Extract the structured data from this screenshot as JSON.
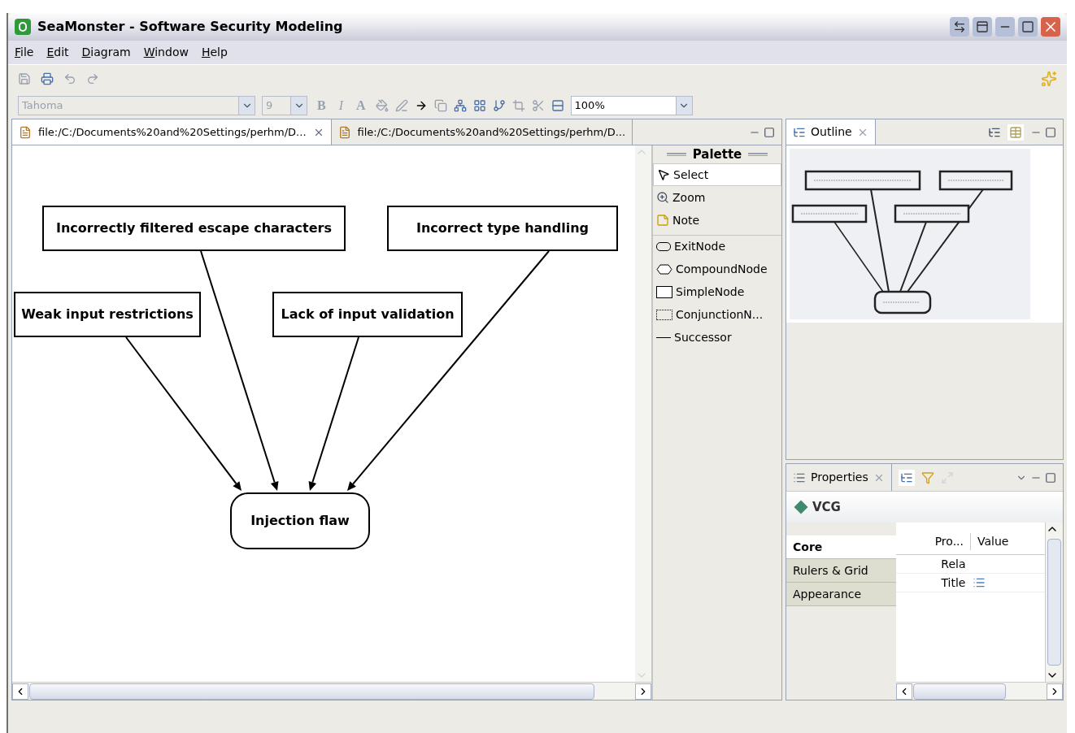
{
  "window": {
    "title": "SeaMonster - Software Security Modeling"
  },
  "menu": [
    "File",
    "Edit",
    "Diagram",
    "Window",
    "Help"
  ],
  "toolbar": {
    "font": "Tahoma",
    "size": "9",
    "format_buttons": [
      "B",
      "I",
      "A"
    ],
    "zoom": "100%"
  },
  "editor_tabs": [
    {
      "label": "file:/C:/Documents%20and%20Settings/perhm/D...",
      "selected": true
    },
    {
      "label": "file:/C:/Documents%20and%20Settings/perhm/D...",
      "selected": false
    }
  ],
  "diagram": {
    "nodes": [
      {
        "label": "Incorrectly filtered escape characters",
        "kind": "cause"
      },
      {
        "label": "Incorrect type handling",
        "kind": "cause"
      },
      {
        "label": "Weak input restrictions",
        "kind": "cause"
      },
      {
        "label": "Lack of input validation",
        "kind": "cause"
      },
      {
        "label": "Injection flaw",
        "kind": "effect"
      }
    ]
  },
  "palette": {
    "title": "Palette",
    "items": [
      {
        "label": "Select",
        "kind": "select",
        "selected": true
      },
      {
        "label": "Zoom",
        "kind": "zoom",
        "selected": false
      },
      {
        "label": "Note",
        "kind": "note",
        "selected": false
      },
      {
        "label": "ExitNode",
        "kind": "exit",
        "selected": false
      },
      {
        "label": "CompoundNode",
        "kind": "compound",
        "selected": false
      },
      {
        "label": "SimpleNode",
        "kind": "simple",
        "selected": false
      },
      {
        "label": "ConjunctionN...",
        "kind": "conjunction",
        "selected": false
      },
      {
        "label": "Successor",
        "kind": "successor",
        "selected": false
      }
    ]
  },
  "outline": {
    "title": "Outline"
  },
  "properties": {
    "title": "Properties",
    "header": "VCG",
    "categories": [
      {
        "label": "Core",
        "selected": true
      },
      {
        "label": "Rulers & Grid",
        "selected": false
      },
      {
        "label": "Appearance",
        "selected": false
      }
    ],
    "columns": [
      "Pro...",
      "Value"
    ],
    "rows": [
      {
        "property": "Rela",
        "has_value_icon": false
      },
      {
        "property": "Title",
        "has_value_icon": true
      }
    ]
  }
}
